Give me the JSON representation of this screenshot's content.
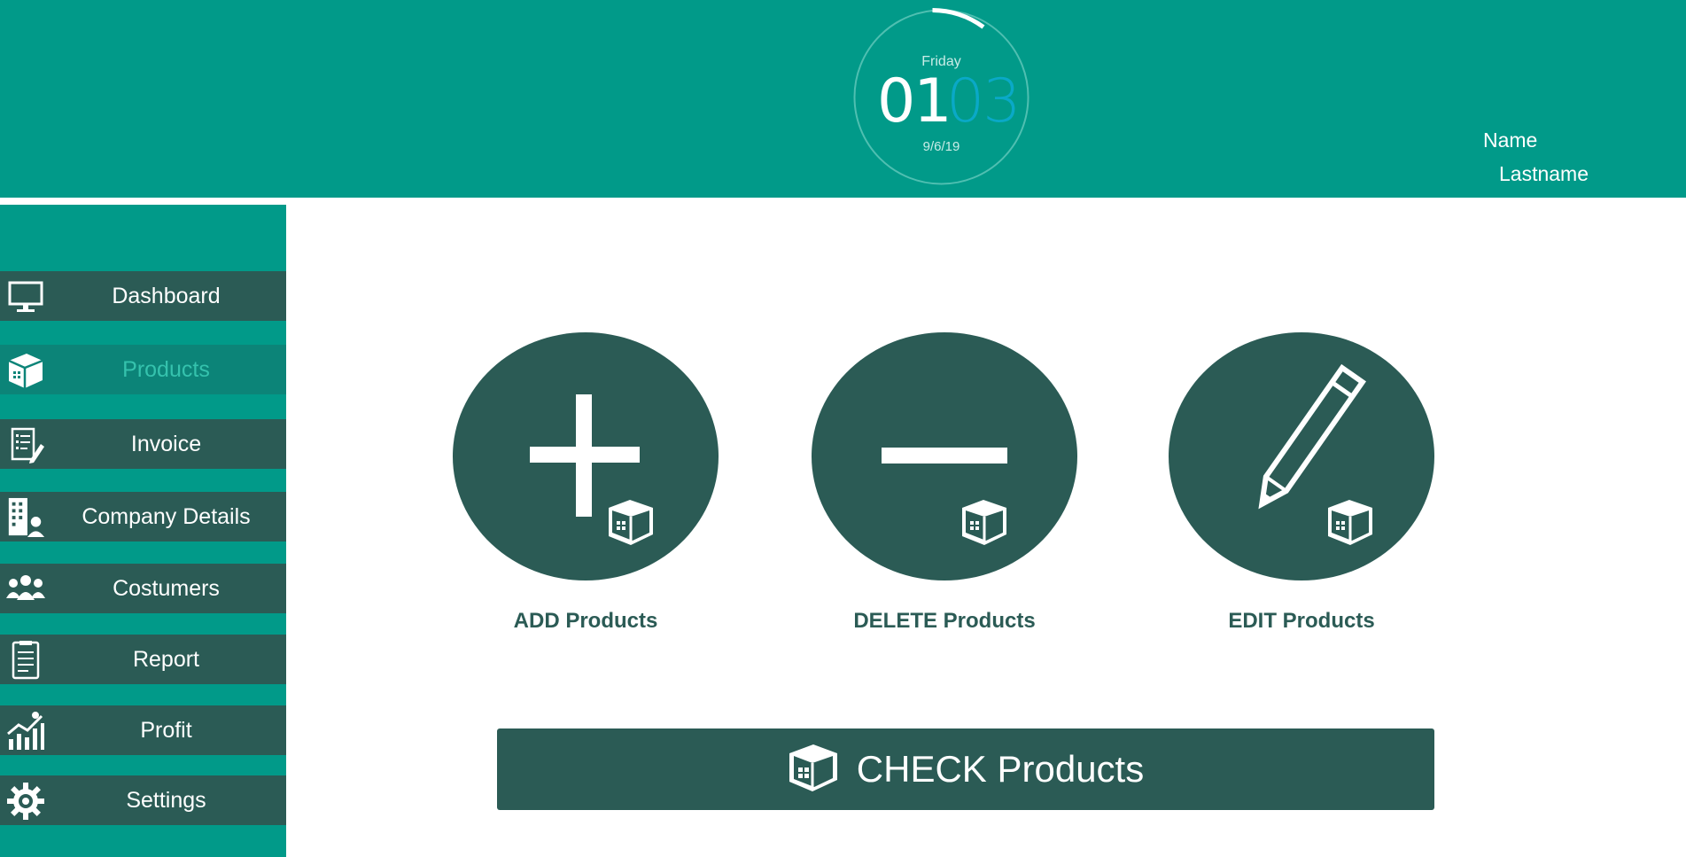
{
  "header": {
    "clock": {
      "day": "Friday",
      "hour": "01",
      "minute": "03",
      "date": "9/6/19"
    },
    "user": {
      "name": "Name",
      "lastname": "Lastname"
    }
  },
  "sidebar": {
    "items": [
      {
        "label": "Dashboard",
        "icon": "monitor-icon",
        "active": false
      },
      {
        "label": "Products",
        "icon": "box-icon",
        "active": true
      },
      {
        "label": "Invoice",
        "icon": "invoice-icon",
        "active": false
      },
      {
        "label": "Company Details",
        "icon": "building-icon",
        "active": false
      },
      {
        "label": "Costumers",
        "icon": "people-icon",
        "active": false
      },
      {
        "label": "Report",
        "icon": "report-icon",
        "active": false
      },
      {
        "label": "Profit",
        "icon": "chart-icon",
        "active": false
      },
      {
        "label": "Settings",
        "icon": "gear-icon",
        "active": false
      }
    ]
  },
  "main": {
    "actions": [
      {
        "label": "ADD Products",
        "icon": "plus-icon"
      },
      {
        "label": "DELETE Products",
        "icon": "minus-icon"
      },
      {
        "label": "EDIT Products",
        "icon": "pencil-icon"
      }
    ],
    "check_button": {
      "label": "CHECK Products",
      "icon": "box-icon"
    }
  },
  "colors": {
    "header_teal": "#019a89",
    "dark_green": "#2b5b55",
    "active_item": "#0c8478",
    "minute_blue": "#0aa9c7"
  }
}
